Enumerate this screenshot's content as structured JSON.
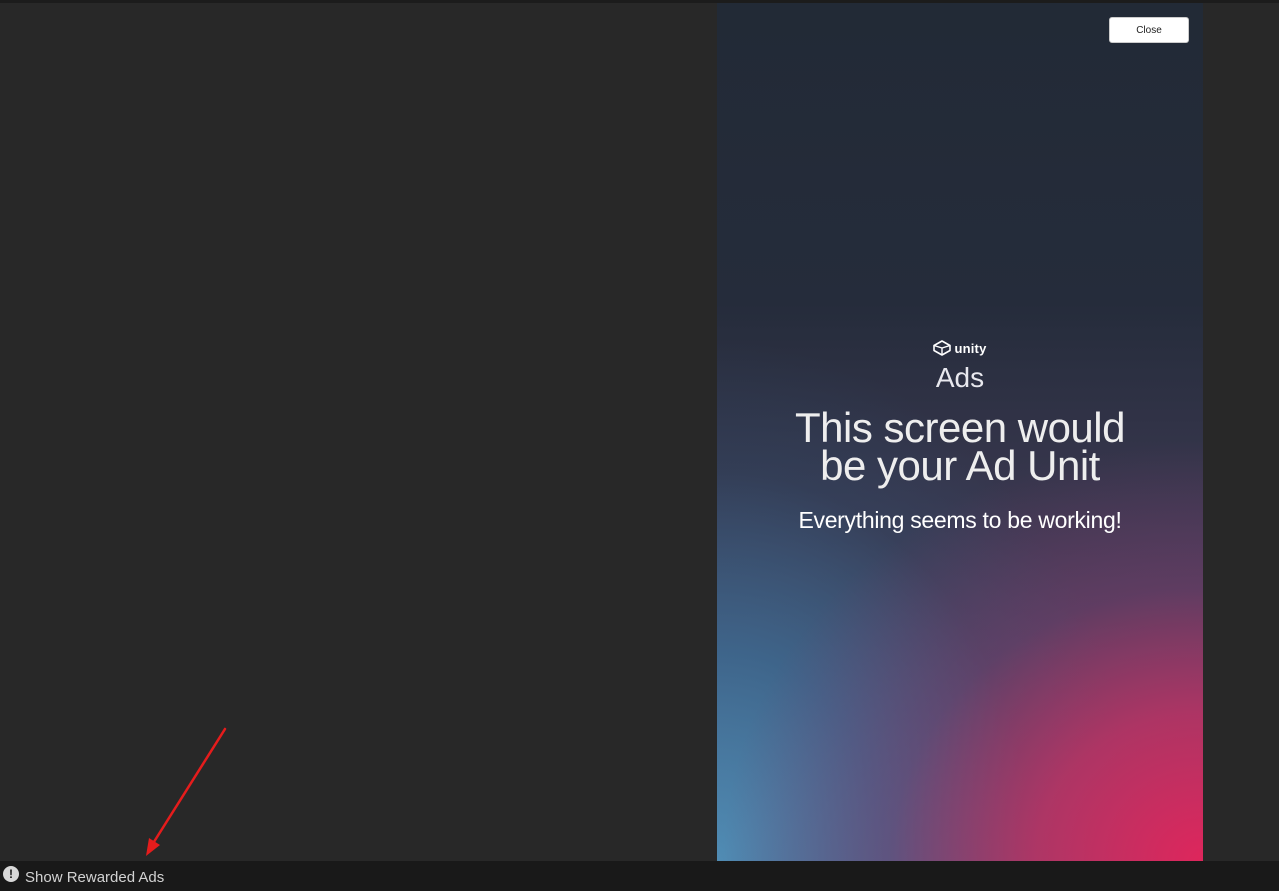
{
  "ad": {
    "close_label": "Close",
    "brand": "unity",
    "product": "Ads",
    "headline_line1": "This screen would",
    "headline_line2": "be your Ad Unit",
    "subline": "Everything seems to be working!",
    "logo_icon": "unity-logo-icon"
  },
  "status_bar": {
    "icon": "warning-icon",
    "message": "Show Rewarded Ads"
  },
  "colors": {
    "editor_background": "#282828",
    "status_bar_background": "#191919",
    "annotation_arrow": "#e51c1c",
    "ad_gradient_top": "#222a36",
    "ad_gradient_pink": "#de265c",
    "ad_gradient_blue": "#508cb4"
  }
}
